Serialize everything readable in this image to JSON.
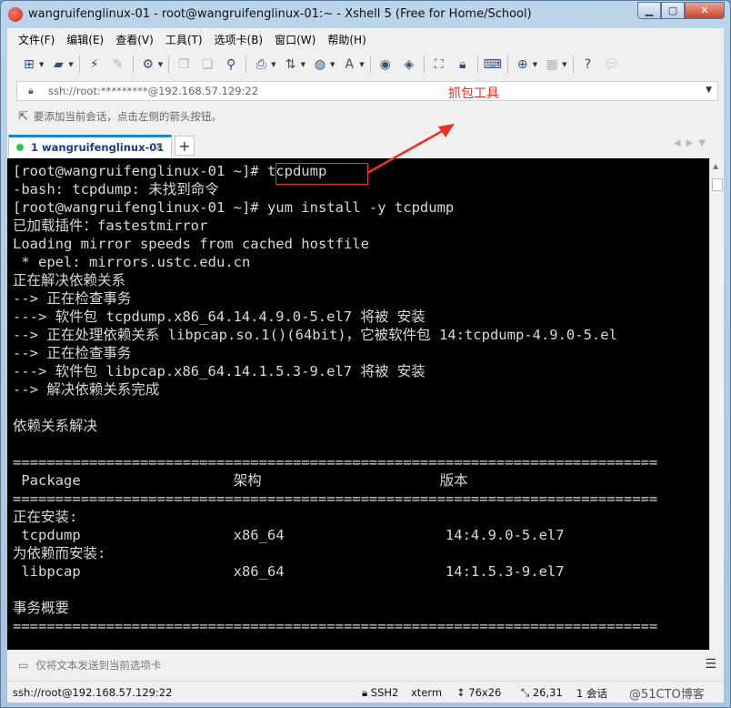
{
  "window": {
    "title": "wangruifenglinux-01 - root@wangruifenglinux-01:~ - Xshell 5 (Free for Home/School)",
    "min": "▁",
    "max": "▢",
    "close": "✕"
  },
  "menu": [
    "文件(F)",
    "编辑(E)",
    "查看(V)",
    "工具(T)",
    "选项卡(B)",
    "窗口(W)",
    "帮助(H)"
  ],
  "address": {
    "text": "ssh://root:*********@192.168.57.129:22"
  },
  "hint": {
    "text": "要添加当前会话，点击左侧的箭头按钮。"
  },
  "annotation": {
    "text": "抓包工具",
    "color": "#e8322a"
  },
  "tab": {
    "label": "1 wangruifenglinux-01",
    "close": "×",
    "add": "+"
  },
  "terminal": {
    "lines": [
      "[root@wangruifenglinux-01 ~]# tcpdump",
      "-bash: tcpdump: 未找到命令",
      "[root@wangruifenglinux-01 ~]# yum install -y tcpdump",
      "已加载插件：fastestmirror",
      "Loading mirror speeds from cached hostfile",
      " * epel: mirrors.ustc.edu.cn",
      "正在解决依赖关系",
      "--> 正在检查事务",
      "---> 软件包 tcpdump.x86_64.14.4.9.0-5.el7 将被 安装",
      "--> 正在处理依赖关系 libpcap.so.1()(64bit)，它被软件包 14:tcpdump-4.9.0-5.el",
      "--> 正在检查事务",
      "---> 软件包 libpcap.x86_64.14.1.5.3-9.el7 将被 安装",
      "--> 解决依赖关系完成",
      "",
      "依赖关系解决",
      "",
      "============================================================================",
      " Package                  架构                     版本",
      "============================================================================",
      "正在安装:",
      " tcpdump                  x86_64                   14:4.9.0-5.el7",
      "为依赖而安装:",
      " libpcap                  x86_64                   14:1.5.3-9.el7",
      "",
      "事务概要",
      "============================================================================"
    ]
  },
  "sendbar": {
    "text": "仅将文本发送到当前选项卡"
  },
  "status": {
    "conn": "ssh://root@192.168.57.129:22",
    "proto": "SSH2",
    "term": "xterm",
    "size": "76x26",
    "pos": "26,31",
    "sessions": "1 会话",
    "watermark": "@51CTO博客"
  }
}
